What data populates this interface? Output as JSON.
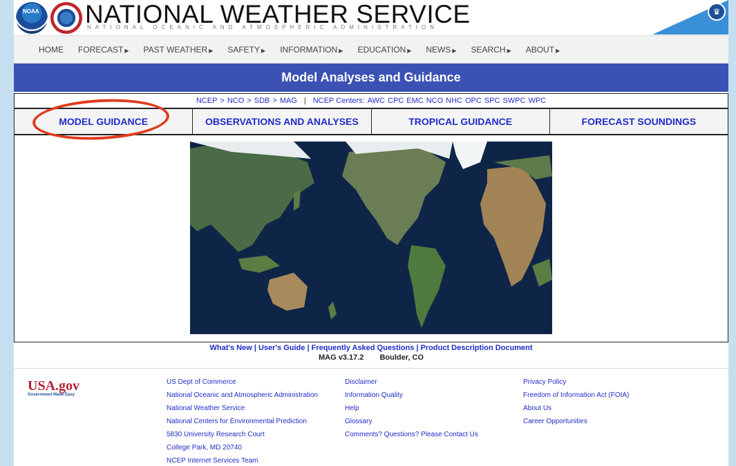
{
  "header": {
    "title": "NATIONAL WEATHER SERVICE",
    "subtitle": "NATIONAL OCEANIC AND ATMOSPHERIC ADMINISTRATION",
    "noaa_logo_text": "NOAA"
  },
  "nav": {
    "items": [
      {
        "label": "HOME",
        "has_menu": false
      },
      {
        "label": "FORECAST",
        "has_menu": true
      },
      {
        "label": "PAST WEATHER",
        "has_menu": true
      },
      {
        "label": "SAFETY",
        "has_menu": true
      },
      {
        "label": "INFORMATION",
        "has_menu": true
      },
      {
        "label": "EDUCATION",
        "has_menu": true
      },
      {
        "label": "NEWS",
        "has_menu": true
      },
      {
        "label": "SEARCH",
        "has_menu": true
      },
      {
        "label": "ABOUT",
        "has_menu": true
      }
    ]
  },
  "page_title": "Model Analyses and Guidance",
  "breadcrumb": {
    "items": [
      "NCEP",
      "NCO",
      "SDB",
      "MAG"
    ],
    "centers_label": "NCEP Centers:",
    "centers": [
      "AWC",
      "CPC",
      "EMC",
      "NCO",
      "NHC",
      "OPC",
      "SPC",
      "SWPC",
      "WPC"
    ]
  },
  "tabs": [
    {
      "label": "MODEL GUIDANCE",
      "highlighted": true
    },
    {
      "label": "OBSERVATIONS AND ANALYSES",
      "highlighted": false
    },
    {
      "label": "TROPICAL GUIDANCE",
      "highlighted": false
    },
    {
      "label": "FORECAST SOUNDINGS",
      "highlighted": false
    }
  ],
  "info_links": [
    "What's New",
    "User's Guide",
    "Frequently Asked Questions",
    "Product Description Document"
  ],
  "version": {
    "label": "MAG v3.17.2",
    "location": "Boulder, CO"
  },
  "footer": {
    "usa_logo": "USA.gov",
    "usa_tagline": "Government Made Easy",
    "col1": [
      "US Dept of Commerce",
      "National Oceanic and Atmospheric Administration",
      "National Weather Service",
      "National Centers for Environmental Prediction",
      "5830 University Research Court",
      "College Park, MD 20740",
      "NCEP Internet Services Team"
    ],
    "col2": [
      "Disclaimer",
      "Information Quality",
      "Help",
      "Glossary",
      "Comments? Questions? Please Contact Us"
    ],
    "col3": [
      "Privacy Policy",
      "Freedom of Information Act (FOIA)",
      "About Us",
      "Career Opportunities"
    ]
  },
  "colors": {
    "title_bar": "#3b52b4",
    "link": "#1f2bc6",
    "highlight": "#e03a1e",
    "ocean": "#0f2548"
  }
}
